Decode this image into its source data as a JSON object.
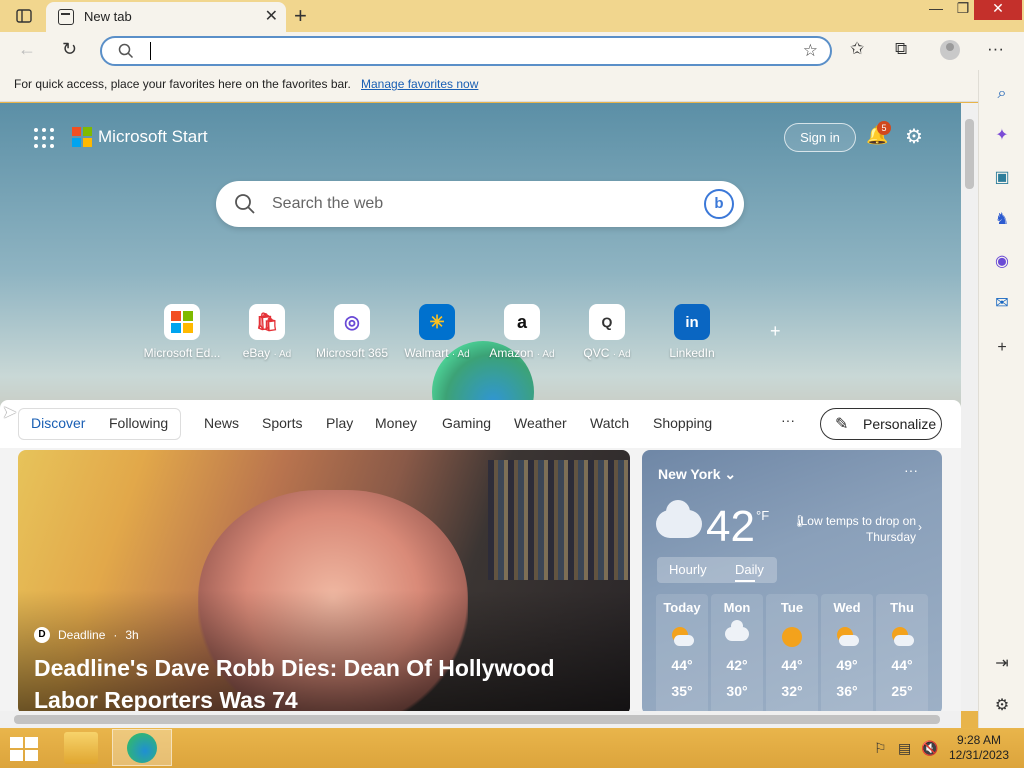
{
  "browser": {
    "tab": {
      "label": "New tab",
      "close_glyph": "✕"
    },
    "new_tab_glyph": "+",
    "window": {
      "minimize": "—",
      "restore": "❐",
      "close": "✕"
    },
    "address": {
      "value": "",
      "placeholder": ""
    },
    "favorites_bar": {
      "message": "For quick access, place your favorites here on the favorites bar.",
      "link": "Manage favorites now"
    }
  },
  "start_page": {
    "brand": "Microsoft Start",
    "sign_in": "Sign in",
    "notifications_count": "5",
    "search_placeholder": "Search the web",
    "bing_glyph": "b",
    "quick_links": [
      {
        "label": "Microsoft Ed...",
        "ad": "",
        "glyph": ""
      },
      {
        "label": "eBay",
        "ad": "· Ad",
        "glyph": "🛍"
      },
      {
        "label": "Microsoft 365",
        "ad": "",
        "glyph": "◎"
      },
      {
        "label": "Walmart",
        "ad": "· Ad",
        "glyph": "✳"
      },
      {
        "label": "Amazon",
        "ad": "· Ad",
        "glyph": "a"
      },
      {
        "label": "QVC",
        "ad": "· Ad",
        "glyph": "Q"
      },
      {
        "label": "LinkedIn",
        "ad": "",
        "glyph": "in"
      }
    ],
    "add_link_glyph": "+",
    "feed_nav": {
      "tabs": [
        "Discover",
        "Following"
      ],
      "items": [
        "News",
        "Sports",
        "Play",
        "Money",
        "Gaming",
        "Weather",
        "Watch",
        "Shopping"
      ],
      "more": "···",
      "personalize": "Personalize"
    },
    "hero_article": {
      "source": "Deadline",
      "source_badge": "D",
      "age": "3h",
      "title": "Deadline's Dave Robb Dies: Dean Of Hollywood Labor Reporters Was 74"
    },
    "weather": {
      "city": "New York",
      "more": "···",
      "temperature": "42",
      "unit": "°F",
      "alert": "Low temps to drop on Thursday",
      "tabs": [
        "Hourly",
        "Daily"
      ],
      "days": [
        {
          "name": "Today",
          "icon": "partly-cloudy-icon",
          "high": "44°",
          "low": "35°"
        },
        {
          "name": "Mon",
          "icon": "cloudy-icon",
          "high": "42°",
          "low": "30°"
        },
        {
          "name": "Tue",
          "icon": "sunny-icon",
          "high": "44°",
          "low": "32°"
        },
        {
          "name": "Wed",
          "icon": "partly-cloudy-icon",
          "high": "49°",
          "low": "36°"
        },
        {
          "name": "Thu",
          "icon": "partly-cloudy-icon",
          "high": "44°",
          "low": "25°"
        }
      ]
    }
  },
  "taskbar": {
    "time": "9:28 AM",
    "date": "12/31/2023"
  },
  "colors": {
    "accent": "#1a5fb4",
    "title_bar": "#f1d68e",
    "taskbar": "#e9b54b",
    "close_button": "#c4302b"
  }
}
